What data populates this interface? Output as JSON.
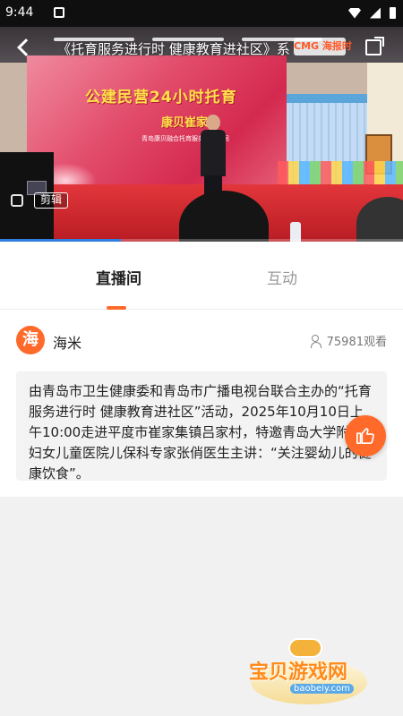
{
  "status_bar": {
    "time": "9:44"
  },
  "video": {
    "title": "《托育服务进行时 健康教育进社区》系",
    "logo_text": "CMG 海报时",
    "banner_title": "公建民营24小时托育",
    "banner_sub": "康贝崔家集",
    "banner_small": "青岛康贝融合托育服务有限公司",
    "clip_label": "剪辑",
    "progress": 0.3
  },
  "tabs": [
    {
      "label": "直播间",
      "active": true
    },
    {
      "label": "互动",
      "active": false
    }
  ],
  "host": {
    "avatar_glyph": "海",
    "name": "海米",
    "viewers": "75981观看"
  },
  "description": "由青岛市卫生健康委和青岛市广播电视台联合主办的“托育服务进行时 健康教育进社区”活动，2025年10月10日上午10:00走进平度市崔家集镇吕家村，特邀青岛大学附属妇女儿童医院儿保科专家张俏医生主讲：“关注婴幼儿的健康饮食”。",
  "watermark": {
    "text": "宝贝游戏网",
    "url": "baobeiy.com"
  },
  "colors": {
    "accent": "#ff6a2b",
    "progress": "#2f7de1"
  }
}
